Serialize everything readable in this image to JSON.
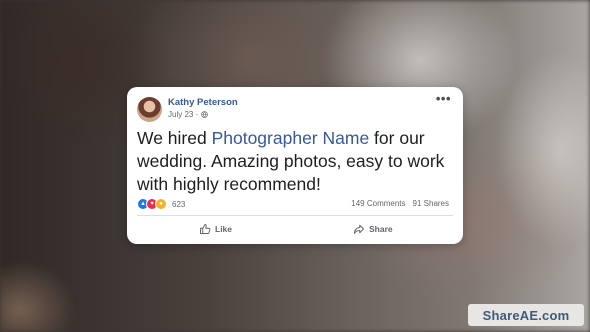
{
  "post": {
    "author": "Kathy Peterson",
    "date": "July 23 ·",
    "text_before": "We hired ",
    "text_link": "Photographer Name",
    "text_after": " for our wedding. Amazing photos, easy to work with highly recommend!",
    "reaction_count": "623",
    "comments": "149 Comments",
    "shares": "91 Shares",
    "reactions": [
      "like",
      "love",
      "wow"
    ]
  },
  "actions": {
    "like_label": "Like",
    "share_label": "Share"
  },
  "watermark": {
    "text": "ShareAE.com"
  },
  "colors": {
    "link": "#385898",
    "like_reaction": "#1877f2",
    "love_reaction": "#f0284a",
    "wow_reaction": "#f7b125"
  },
  "icons": [
    "globe-icon",
    "more-options-icon",
    "like-icon",
    "share-icon",
    "like-reaction-icon",
    "love-reaction-icon",
    "wow-reaction-icon"
  ]
}
